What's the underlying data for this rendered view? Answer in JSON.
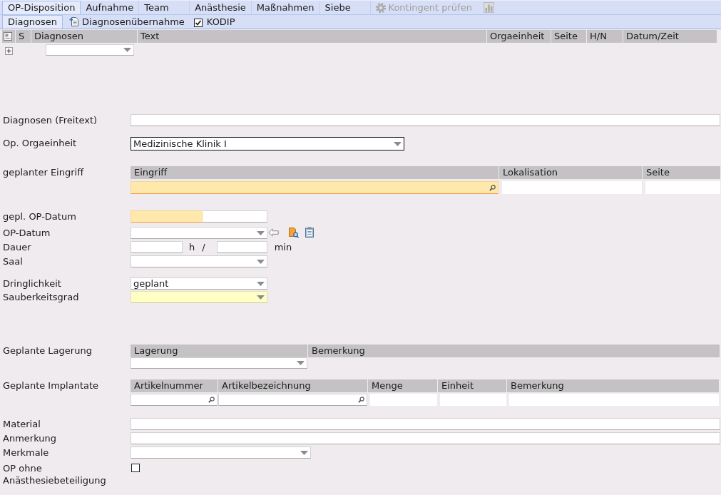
{
  "main_tabs": [
    {
      "label": "OP-Disposition",
      "selected": true
    },
    {
      "label": "Aufnahme",
      "selected": false
    },
    {
      "label": "Team",
      "selected": false
    },
    {
      "label": "Anästhesie",
      "selected": false
    },
    {
      "label": "Maßnahmen",
      "selected": false
    },
    {
      "label": "Siebe",
      "selected": false
    }
  ],
  "main_toolbar": [
    {
      "kind": "gear",
      "label": "Kontingent prüfen",
      "disabled": true
    },
    {
      "kind": "chart",
      "disabled": true
    }
  ],
  "sub_tabs": [
    {
      "label": "Diagnosen",
      "selected": true
    }
  ],
  "sub_toolbar": [
    {
      "kind": "button",
      "label": "Diagnosenübernahme"
    },
    {
      "kind": "checkbox",
      "label": "KODIP",
      "checked": true
    }
  ],
  "diagnoses_table": {
    "columns": [
      "S",
      "Diagnosen",
      "Text",
      "Orgaeinheit",
      "Seite",
      "H/N",
      "Datum/Zeit"
    ],
    "rows": [
      {
        "expanded": false
      }
    ]
  },
  "form": {
    "groups": [
      [
        {
          "kind": "text",
          "label": "Diagnosen (Freitext)"
        }
      ],
      [
        {
          "kind": "select",
          "label": "Op. Orgaeinheit",
          "value": "Medizinische Klinik I",
          "focused": true
        }
      ],
      [
        {
          "kind": "grid",
          "label": "geplanter Eingriff",
          "columns": [
            {
              "label": "Eingriff",
              "kind": "search",
              "required": true
            },
            {
              "label": "Lokalisation",
              "kind": "text",
              "required": false
            },
            {
              "label": "Seite",
              "kind": "text",
              "required": false
            }
          ]
        }
      ],
      [
        {
          "kind": "datetime",
          "label": "gepl. OP-Datum",
          "required": true
        },
        {
          "kind": "select",
          "label": "OP-Datum",
          "actions": [
            {
              "kind": "arrow"
            },
            {
              "kind": "document-search"
            },
            {
              "kind": "clipboard"
            }
          ]
        },
        {
          "kind": "duration",
          "label": "Dauer",
          "hours_unit": "h",
          "separator": "/",
          "minutes_unit": "min"
        },
        {
          "kind": "select",
          "label": "Saal"
        }
      ],
      [
        {
          "kind": "select",
          "label": "Dringlichkeit",
          "value": "geplant"
        },
        {
          "kind": "select",
          "label": "Sauberkeitsgrad",
          "recommended": true
        }
      ],
      [
        {
          "kind": "grid",
          "label": "Geplante Lagerung",
          "columns": [
            {
              "label": "Lagerung",
              "kind": "select"
            },
            {
              "label": "Bemerkung",
              "kind": "none"
            }
          ]
        }
      ],
      [
        {
          "kind": "grid",
          "label": "Geplante Implantate",
          "columns": [
            {
              "label": "Artikelnummer",
              "kind": "search"
            },
            {
              "label": "Artikelbezeichnung",
              "kind": "search"
            },
            {
              "label": "Menge",
              "kind": "text"
            },
            {
              "label": "Einheit",
              "kind": "text"
            },
            {
              "label": "Bemerkung",
              "kind": "text"
            }
          ]
        }
      ],
      [
        {
          "kind": "text",
          "label": "Material"
        },
        {
          "kind": "text",
          "label": "Anmerkung"
        },
        {
          "kind": "select",
          "label": "Merkmale"
        },
        {
          "kind": "checkbox",
          "label": "OP ohne Anästhesiebeteiligung",
          "checked": false
        }
      ]
    ]
  }
}
